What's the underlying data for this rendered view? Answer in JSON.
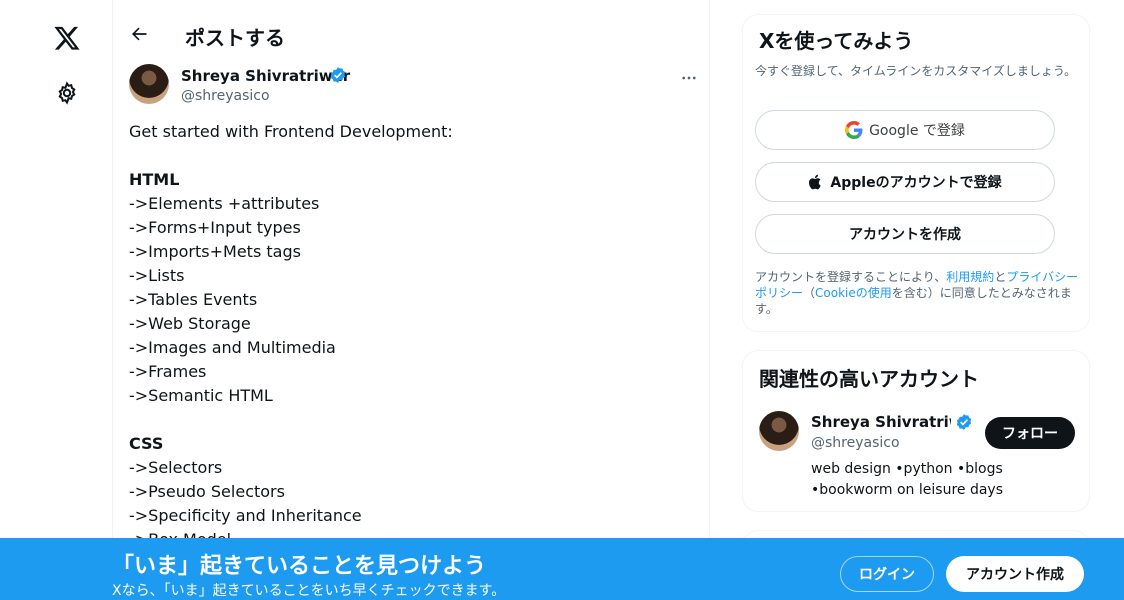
{
  "nav": {
    "logo_icon": "x-logo-icon",
    "settings_icon": "gear-icon"
  },
  "header": {
    "back_icon": "arrow-left-icon",
    "title": "ポストする"
  },
  "post": {
    "author_name": "Shreya Shivratriwar",
    "author_handle": "@shreyasico",
    "verified": true,
    "lines": [
      {
        "text": "Get started with Frontend Development:",
        "bold": false
      },
      {
        "text": "",
        "bold": false
      },
      {
        "text": "HTML",
        "bold": true
      },
      {
        "text": "->Elements +attributes",
        "bold": false
      },
      {
        "text": "->Forms+Input types",
        "bold": false
      },
      {
        "text": "->Imports+Mets tags",
        "bold": false
      },
      {
        "text": "->Lists",
        "bold": false
      },
      {
        "text": "->Tables Events",
        "bold": false
      },
      {
        "text": "->Web Storage",
        "bold": false
      },
      {
        "text": "->Images and Multimedia",
        "bold": false
      },
      {
        "text": "->Frames",
        "bold": false
      },
      {
        "text": "->Semantic HTML",
        "bold": false
      },
      {
        "text": "",
        "bold": false
      },
      {
        "text": "CSS",
        "bold": true
      },
      {
        "text": "->Selectors",
        "bold": false
      },
      {
        "text": "->Pseudo Selectors",
        "bold": false
      },
      {
        "text": "->Specificity and Inheritance",
        "bold": false
      },
      {
        "text": "->Box Model",
        "bold": false
      }
    ]
  },
  "signup_card": {
    "title": "Xを使ってみよう",
    "subtitle": "今すぐ登録して、タイムラインをカスタマイズしましょう。",
    "google_label": "Google で登録",
    "apple_label": "Appleのアカウントで登録",
    "create_label": "アカウントを作成",
    "terms_prefix": "アカウントを登録することにより、",
    "terms_link": "利用規約",
    "terms_and": "と",
    "privacy_link": "プライバシーポリシー",
    "terms_paren_open": "（",
    "cookie_link": "Cookieの使用",
    "terms_suffix": "を含む）に同意したとみなされます。"
  },
  "related": {
    "title": "関連性の高いアカウント",
    "name": "Shreya Shivratriwar",
    "handle": "@shreyasico",
    "follow_label": "フォロー",
    "bio": "web design •python •blogs •bookworm on leisure days"
  },
  "banner": {
    "title": "「いま」起きていることを見つけよう",
    "subtitle": "Xなら、「いま」起きていることをいち早くチェックできます。",
    "login_label": "ログイン",
    "signup_label": "アカウント作成"
  },
  "colors": {
    "accent": "#1d9bf0",
    "text": "#0f1419",
    "muted": "#536471"
  }
}
